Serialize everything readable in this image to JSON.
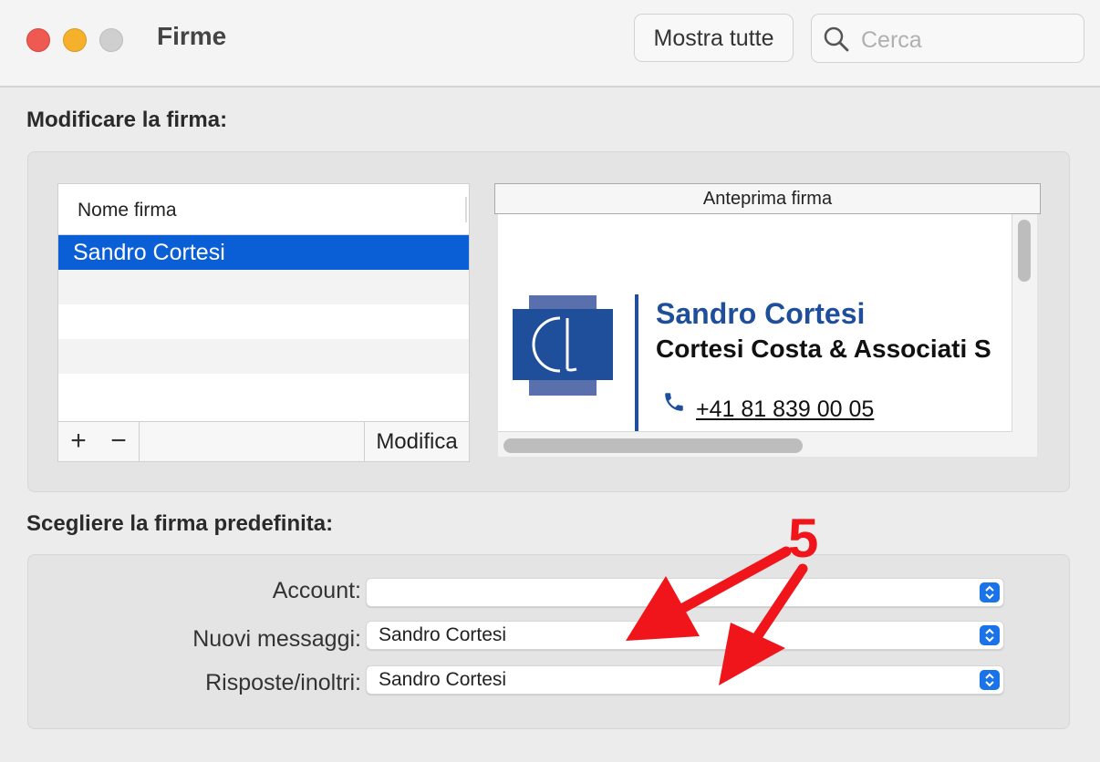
{
  "window": {
    "title": "Firme",
    "show_all_label": "Mostra tutte",
    "search_placeholder": "Cerca"
  },
  "edit_section": {
    "heading": "Modificare la firma:",
    "list_header": "Nome firma",
    "signatures": [
      "Sandro Cortesi"
    ],
    "add_label": "+",
    "remove_label": "−",
    "edit_label": "Modifica",
    "preview_header": "Anteprima firma",
    "preview": {
      "name": "Sandro Cortesi",
      "company": "Cortesi Costa & Associati S",
      "phone": "+41 81 839 00 05"
    }
  },
  "default_section": {
    "heading": "Scegliere la firma predefinita:",
    "account_label": "Account:",
    "account_value": "",
    "new_messages_label": "Nuovi messaggi:",
    "new_messages_value": "Sandro Cortesi",
    "replies_label": "Risposte/inoltri:",
    "replies_value": "Sandro Cortesi"
  },
  "annotation": {
    "number": "5",
    "color": "#f0151a"
  },
  "colors": {
    "selection": "#0a5fd6",
    "brand_blue": "#1f4f9b",
    "stepper_blue": "#1a73e8"
  }
}
